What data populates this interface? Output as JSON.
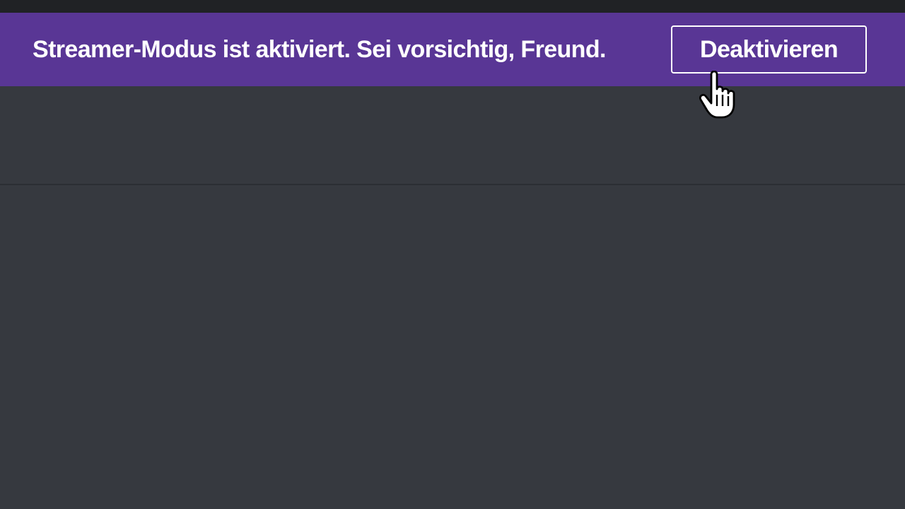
{
  "notice": {
    "message": "Streamer-Modus ist aktiviert. Sei vorsichtig, Freund.",
    "button_label": "Deaktivieren",
    "background_color": "#593695"
  },
  "cursor": {
    "icon": "hand-pointer-icon"
  },
  "colors": {
    "titlebar": "#202225",
    "main_background": "#36393f",
    "text": "#ffffff"
  }
}
